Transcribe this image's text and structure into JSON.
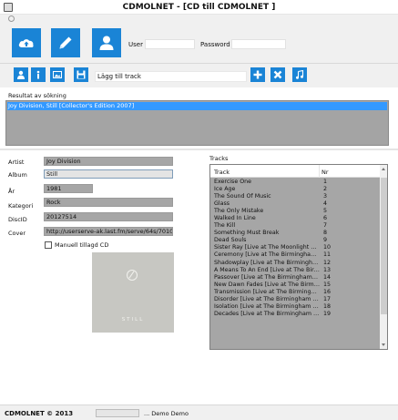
{
  "window": {
    "title": "CDMOLNET - [CD till CDMOLNET ]"
  },
  "topbar": {
    "buttons": [
      {
        "name": "cloud-upload",
        "icon": "cloud-upload-icon"
      },
      {
        "name": "edit",
        "icon": "pencil-icon"
      },
      {
        "name": "user",
        "icon": "user-icon"
      }
    ],
    "user_label": "User",
    "user_value": "",
    "password_label": "Password",
    "password_value": ""
  },
  "toolbar": {
    "icons": [
      "person-search-icon",
      "info-icon",
      "image-icon",
      "save-icon"
    ],
    "track_input": "Lägg till track",
    "right_icons": [
      "add-icon",
      "delete-icon",
      "music-note-icon"
    ],
    "accent_color": "#1a84d6"
  },
  "results": {
    "label": "Resultat av sökning",
    "items": [
      "Joy Division, Still [Collector's Edition 2007]"
    ]
  },
  "form": {
    "artist_label": "Artist",
    "artist": "Joy Division",
    "album_label": "Album",
    "album": "Still",
    "year_label": "År",
    "year": "1981",
    "category_label": "Kategori",
    "category": "Rock",
    "discid_label": "DiscID",
    "discid": "20127514",
    "cover_label": "Cover",
    "cover": "http://userserve-ak.last.fm/serve/64s/70101092.",
    "manual_label": "Manuell tillagd CD",
    "manual_checked": false
  },
  "cover_art": {
    "text": "STILL"
  },
  "tracks": {
    "label": "Tracks",
    "col_track": "Track",
    "col_nr": "Nr",
    "rows": [
      {
        "name": "Exercise One",
        "nr": "1"
      },
      {
        "name": "Ice Age",
        "nr": "2"
      },
      {
        "name": "The Sound Of Music",
        "nr": "3"
      },
      {
        "name": "Glass",
        "nr": "4"
      },
      {
        "name": "The Only Mistake",
        "nr": "5"
      },
      {
        "name": "Walked In Line",
        "nr": "6"
      },
      {
        "name": "The Kill",
        "nr": "7"
      },
      {
        "name": "Something Must Break",
        "nr": "8"
      },
      {
        "name": "Dead Souls",
        "nr": "9"
      },
      {
        "name": "Sister Ray [Live at The Moonlight Club...",
        "nr": "10"
      },
      {
        "name": "Ceremony [Live at The Birmingham High...",
        "nr": "11"
      },
      {
        "name": "Shadowplay [Live at The Birmingham ...",
        "nr": "12"
      },
      {
        "name": "A Means To An End [Live at The Birmi...",
        "nr": "13"
      },
      {
        "name": "Passover [Live at The Birmingham Hig...",
        "nr": "14"
      },
      {
        "name": "New Dawn Fades [Live at The Birmingh...",
        "nr": "15"
      },
      {
        "name": "Transmission [Live at The Birmingham ...",
        "nr": "16"
      },
      {
        "name": "Disorder [Live at The Birmingham High...",
        "nr": "17"
      },
      {
        "name": "Isolation [Live at The Birmingham High...",
        "nr": "18"
      },
      {
        "name": "Decades [Live at The Birmingham High...",
        "nr": "19"
      }
    ]
  },
  "status": {
    "brand": "CDMOLNET © 2013",
    "text": "... Demo Demo",
    "progress": 0
  }
}
